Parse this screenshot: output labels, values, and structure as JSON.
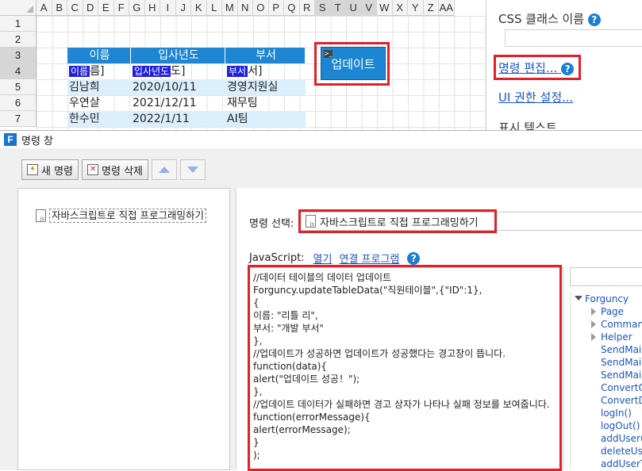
{
  "sheet": {
    "columns": [
      "A",
      "B",
      "C",
      "D",
      "E",
      "F",
      "G",
      "H",
      "I",
      "J",
      "K",
      "L",
      "M",
      "N",
      "O",
      "P",
      "Q",
      "R",
      "S",
      "T",
      "U",
      "V",
      "W",
      "X",
      "Y",
      "Z",
      "AA"
    ],
    "rows": [
      "1",
      "2",
      "3",
      "4",
      "5",
      "6",
      "7"
    ],
    "table": {
      "headers": [
        "이름",
        "입사년도",
        "부서"
      ],
      "row4": {
        "c1_chip": "이름",
        "c1_rest": "름]",
        "c2_chip": "입사년도",
        "c2_rest": "도]",
        "c3_chip": "부서",
        "c3_rest": "서]"
      },
      "rows": [
        [
          "김남희",
          "2020/10/11",
          "경영지원실"
        ],
        [
          "우연살",
          "2021/12/11",
          "재무팀"
        ],
        [
          "한수민",
          "2022/1/11",
          "AI팀"
        ]
      ]
    },
    "update_button": "업데이트",
    "update_button_mini": ">_"
  },
  "props": {
    "css_label": "CSS 클래스 이름",
    "command_edit": "명령 편집...",
    "ui_permission": "UI 권한 설정...",
    "display_text": "표시 텍스트",
    "help_glyph": "?"
  },
  "command_window": {
    "icon_letter": "F",
    "title": "명령 창",
    "toolbar": {
      "new": "새 명령",
      "delete": "명령 삭제"
    },
    "tree_item": "자바스크립트로 직접 프로그래밍하기",
    "select_label": "명령 선택:",
    "select_value": "자바스크립트로 직접 프로그래밍하기",
    "js_label": "JavaScript:",
    "js_open": "열기",
    "js_link": "연결 프로그램",
    "code": [
      "//데이터 테이블의 데이터 업데이트",
      "Forguncy.updateTableData(\"직원테이블\",{\"ID\":1},",
      "{",
      "이름: \"리틀 리\",",
      "부서: \"개발 부서\"",
      "},",
      "//업데이트가 성공하면 업데이트가 성공했다는 경고창이 뜹니다.",
      "function(data){",
      "alert(\"업데이트 성공！\");",
      "},",
      "//업데이트 데이터가 실패하면 경고 상자가 나타나 실패 정보를 보여줍니다.",
      "function(errorMessage){",
      "alert(errorMessage);",
      "}",
      ");"
    ],
    "api_tree": {
      "root": "Forguncy",
      "groups": [
        "Page",
        "Commands",
        "Helper"
      ],
      "items": [
        "SendMail",
        "SendMail",
        "SendMail",
        "ConvertO",
        "ConvertD",
        "logIn()",
        "logOut()",
        "addUser()",
        "deleteUse",
        "addUserT",
        "deleteUse"
      ]
    }
  }
}
